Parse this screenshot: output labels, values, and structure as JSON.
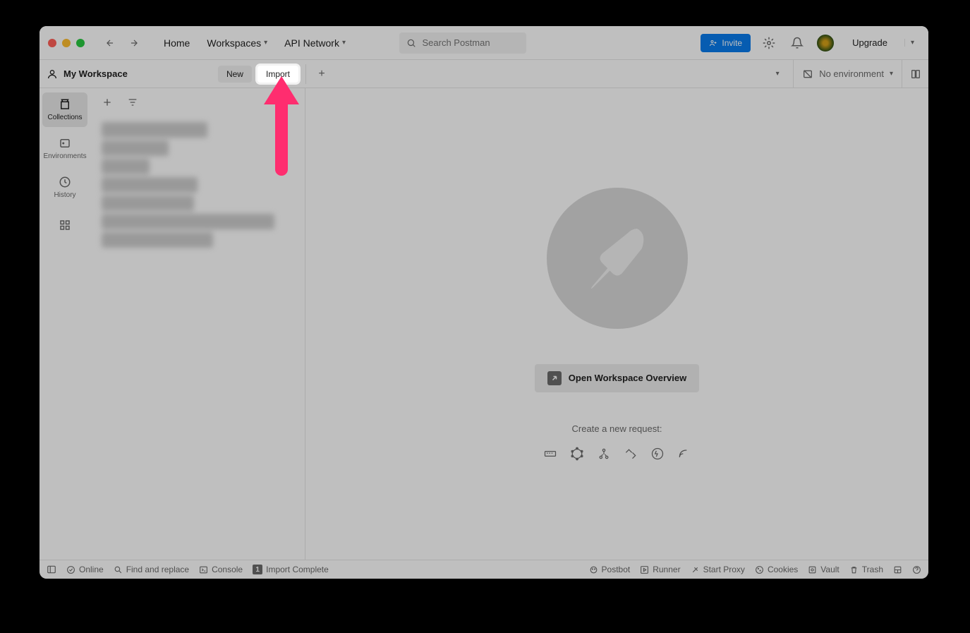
{
  "nav": {
    "home": "Home",
    "workspaces": "Workspaces",
    "api_network": "API Network"
  },
  "search": {
    "placeholder": "Search Postman"
  },
  "header": {
    "invite": "Invite",
    "upgrade": "Upgrade"
  },
  "workspace": {
    "title": "My Workspace",
    "new_btn": "New",
    "import_btn": "Import"
  },
  "env": {
    "label": "No environment"
  },
  "rail": {
    "collections": "Collections",
    "environments": "Environments",
    "history": "History"
  },
  "content": {
    "open_overview": "Open Workspace Overview",
    "create_request": "Create a new request:"
  },
  "statusbar": {
    "online": "Online",
    "find_replace": "Find and replace",
    "console": "Console",
    "import_complete": "Import Complete",
    "import_count": "1",
    "postbot": "Postbot",
    "runner": "Runner",
    "start_proxy": "Start Proxy",
    "cookies": "Cookies",
    "vault": "Vault",
    "trash": "Trash"
  }
}
